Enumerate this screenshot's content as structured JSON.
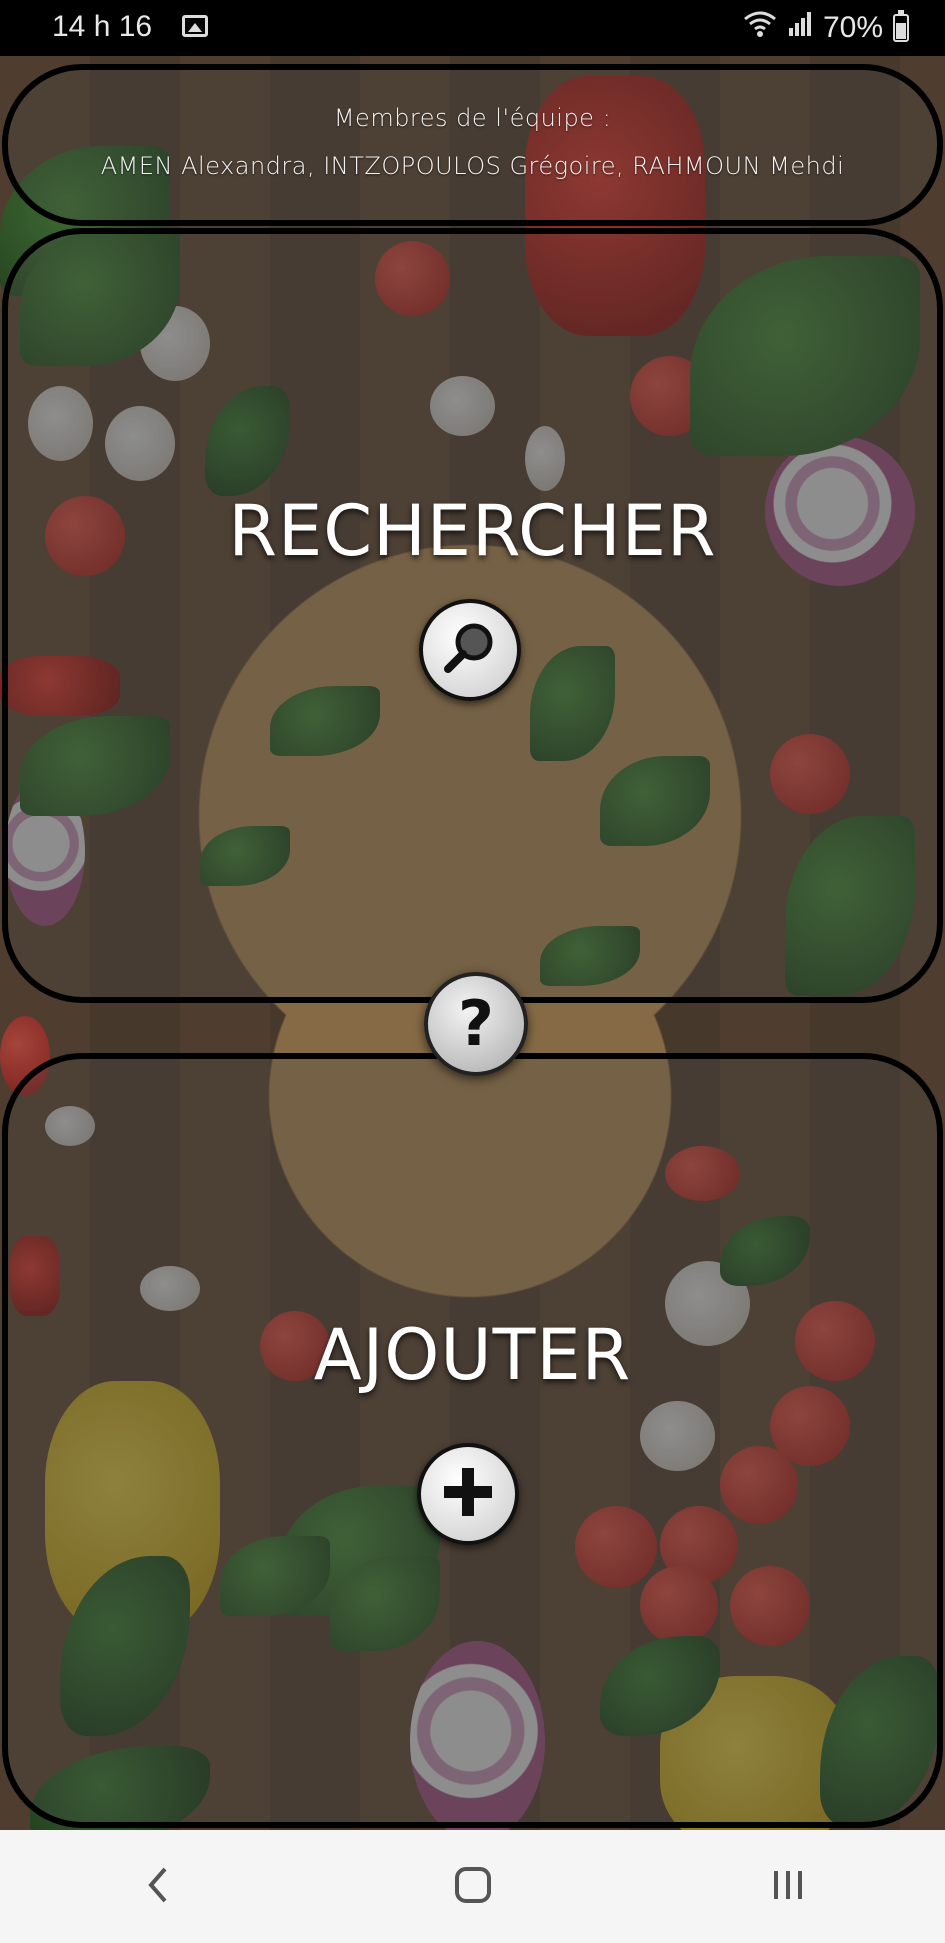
{
  "status_bar": {
    "time": "14 h 16",
    "battery": "70%",
    "icons": [
      "image-icon",
      "wifi-icon",
      "signal-icon",
      "battery-icon"
    ]
  },
  "team": {
    "title": "Membres de l'équipe :",
    "members": "AMEN Alexandra, INTZOPOULOS Grégoire, RAHMOUN Mehdi"
  },
  "search": {
    "label": "RECHERCHER",
    "icon": "magnifier-icon"
  },
  "help": {
    "icon": "question-mark-icon",
    "glyph": "?"
  },
  "add": {
    "label": "AJOUTER",
    "icon": "plus-icon"
  },
  "nav": {
    "icons": [
      "back-icon",
      "home-icon",
      "recents-icon"
    ]
  },
  "colors": {
    "panel_border": "#000000",
    "label_text": "#ffffff",
    "nav_background": "#f5f5f5"
  }
}
